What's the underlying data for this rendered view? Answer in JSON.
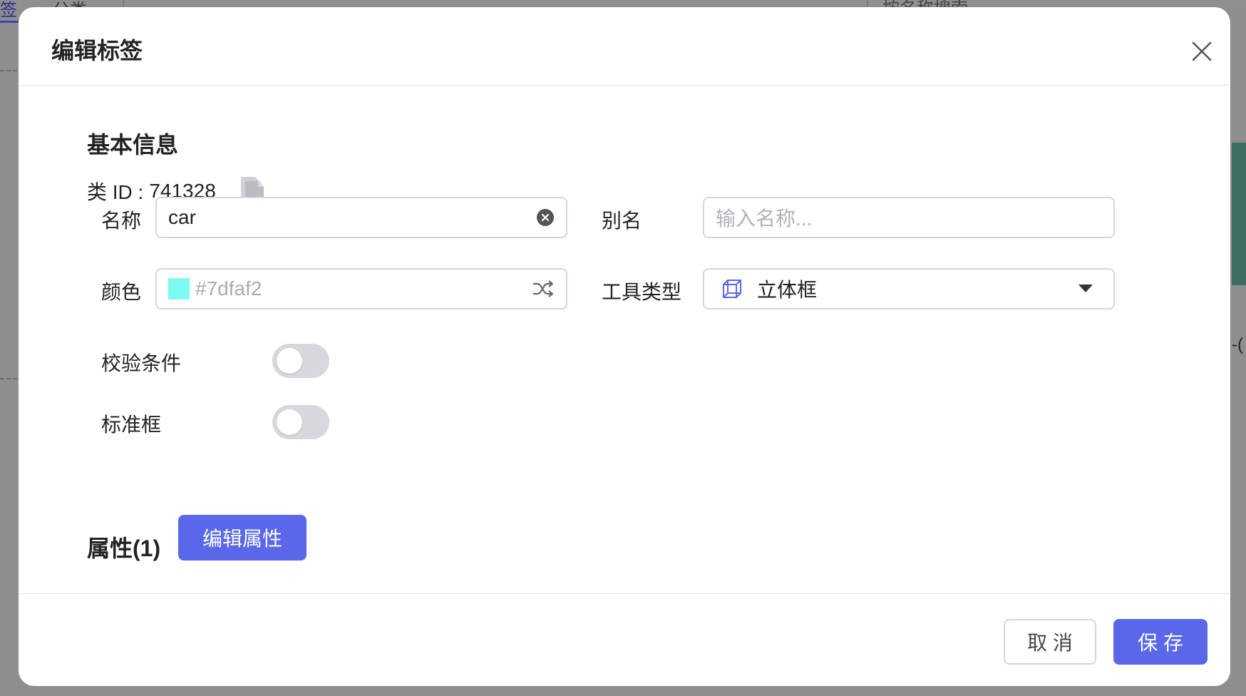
{
  "background": {
    "tab_active": "签",
    "tab_other": "分类",
    "search_hint": "按名称搜索",
    "right_edge_text": "-("
  },
  "modal": {
    "title": "编辑标签",
    "section_title": "基本信息",
    "class_id_label": "类 ID :",
    "class_id_value": "741328",
    "name_label": "名称",
    "name_value": "car",
    "alias_label": "别名",
    "alias_placeholder": "输入名称...",
    "color_label": "颜色",
    "color_value": "#7dfaf2",
    "tool_type_label": "工具类型",
    "tool_type_value": "立体框",
    "validation_label": "校验条件",
    "validation_enabled": false,
    "standard_box_label": "标准框",
    "standard_box_enabled": false,
    "attributes_label": "属性(1)",
    "edit_attributes_label": "编辑属性",
    "cancel_label": "取 消",
    "save_label": "保 存"
  },
  "colors": {
    "primary": "#5a67e8",
    "swatch": "#7dfaf2",
    "toggle_off": "#d6d8dd"
  },
  "icons": [
    "close-icon",
    "copy-icon",
    "clear-icon",
    "shuffle-icon",
    "cube-icon",
    "chevron-down-icon"
  ]
}
